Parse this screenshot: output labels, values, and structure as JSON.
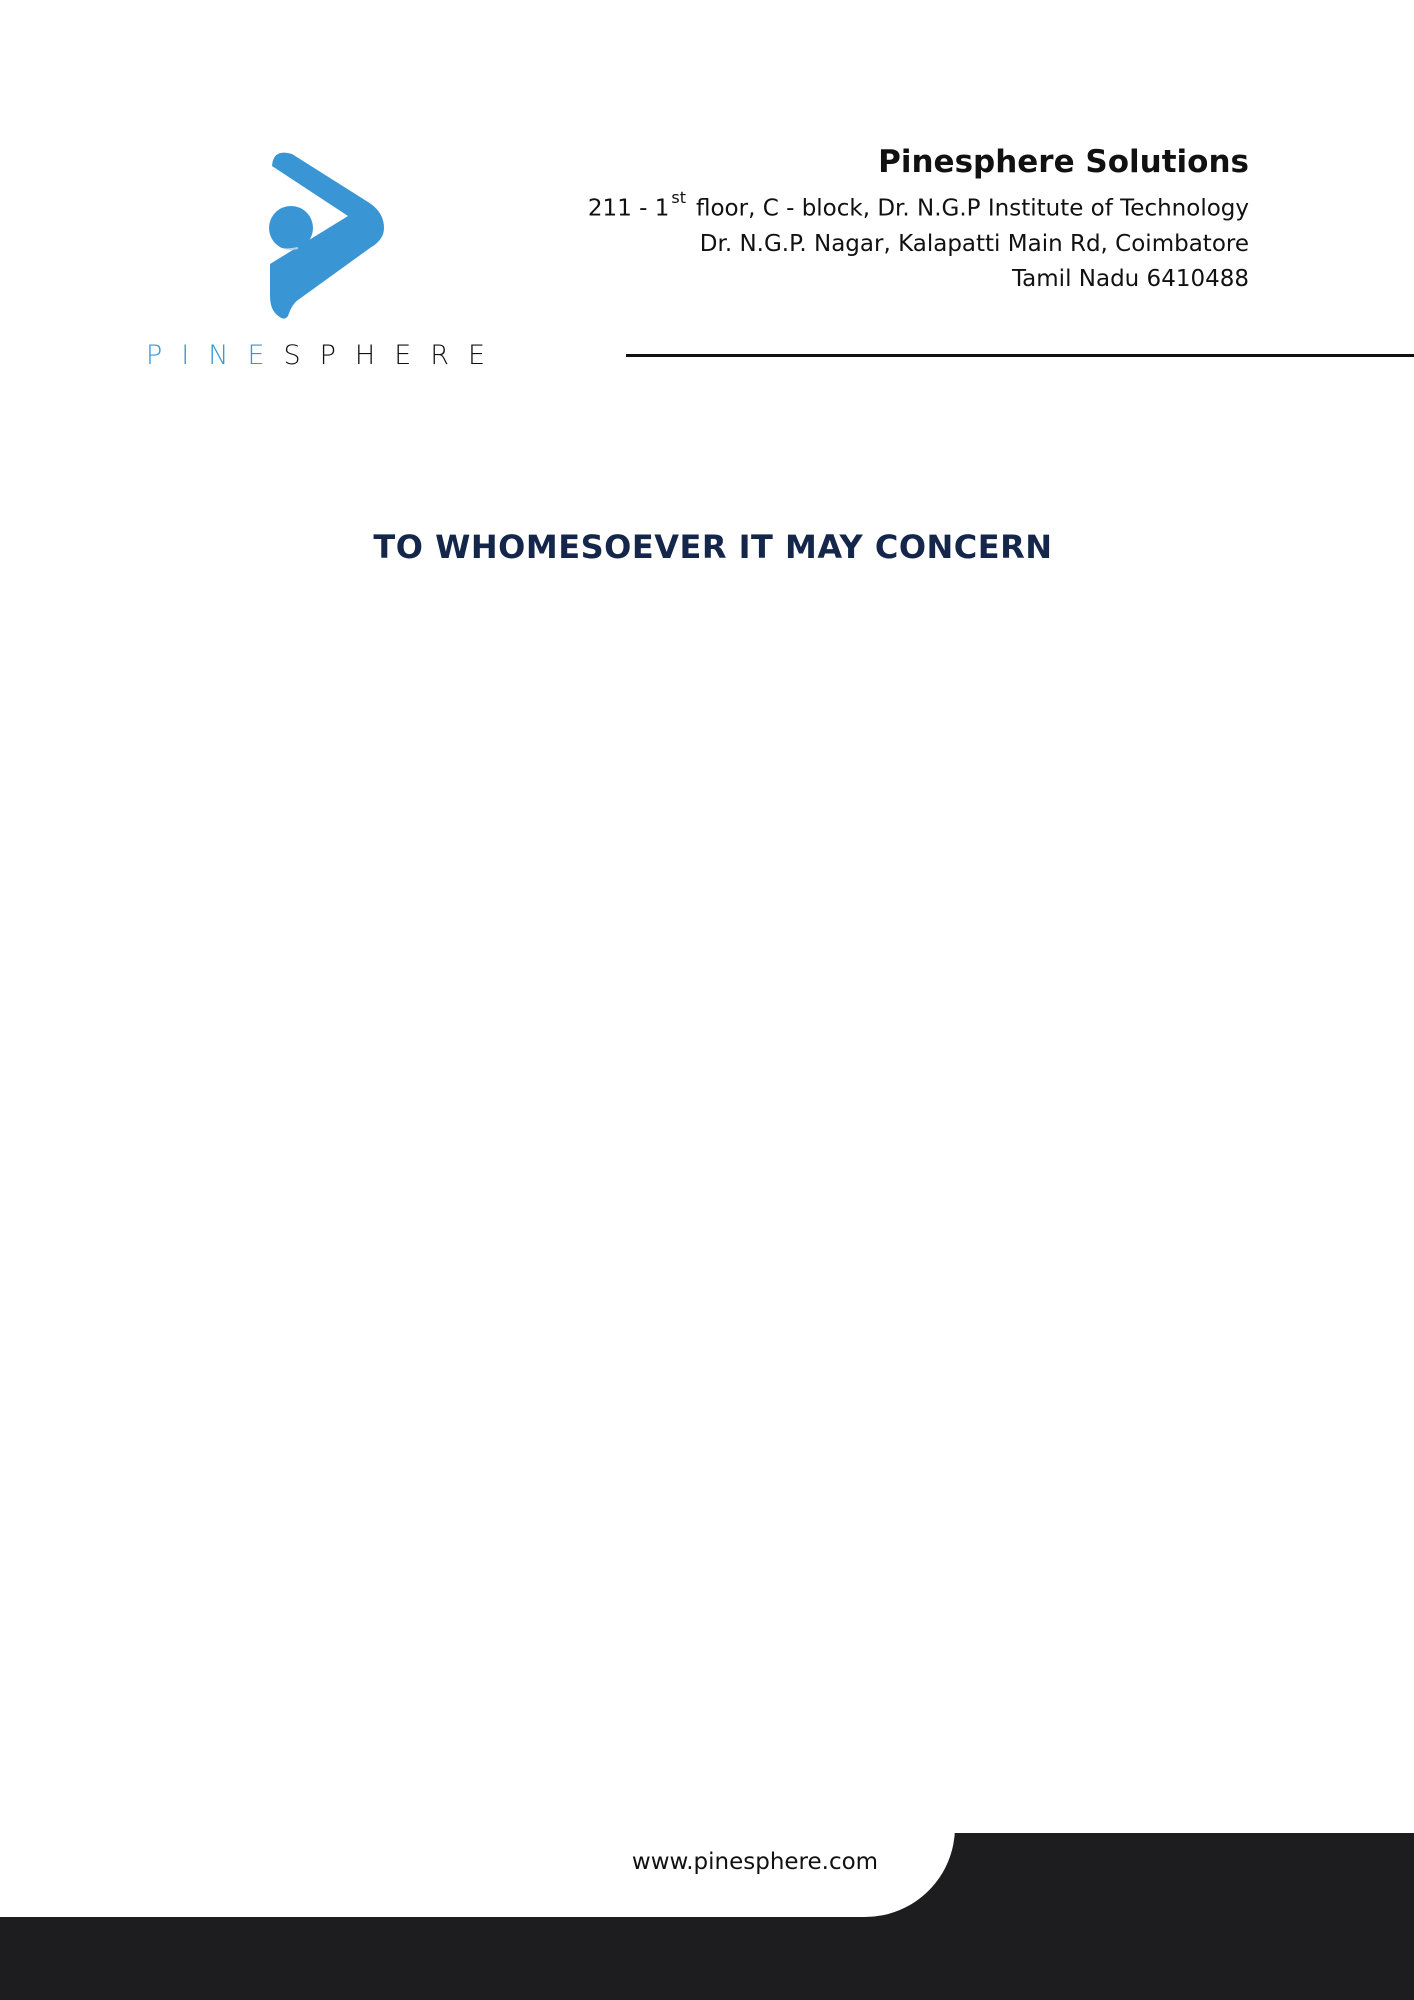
{
  "logo": {
    "icon": "pinesphere-logo-icon",
    "wordmark_part1": "PINE",
    "wordmark_part2": "SPHERE",
    "colors": {
      "brand_blue": "#3a95d4",
      "dark": "#111111"
    }
  },
  "header": {
    "company_name": "Pinesphere Solutions",
    "address_line1_pre": "211 - 1",
    "address_line1_sup": "st",
    "address_line1_post": "floor, C - block, Dr. N.G.P Institute of Technology",
    "address_line2": "Dr. N.G.P. Nagar, Kalapatti Main Rd, Coimbatore",
    "address_line3": "Tamil Nadu 6410488"
  },
  "body": {
    "title": "TO WHOMESOEVER IT MAY CONCERN",
    "title_color": "#14274a"
  },
  "footer": {
    "website": "www.pinesphere.com",
    "band_color": "#1d1d1f"
  }
}
